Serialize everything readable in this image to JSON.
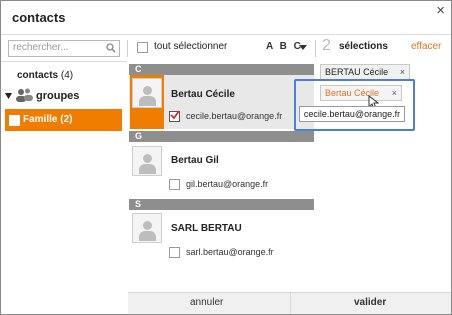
{
  "dialog": {
    "title": "contacts",
    "close_glyph": "×"
  },
  "toolbar": {
    "search_placeholder": "rechercher...",
    "select_all_label": "tout sélectionner",
    "sort_label": "A B C",
    "selection_count": "2",
    "selections_label": "sélections",
    "clear_label": "effacer"
  },
  "sidebar": {
    "contacts_label": "contacts",
    "contacts_count": "(4)",
    "groups_label": "groupes",
    "famille_label": "Famille (2)"
  },
  "contacts": {
    "groups": [
      {
        "letter": "C",
        "name": "Bertau Cécile",
        "email": "cecile.bertau@orange.fr",
        "checked": true
      },
      {
        "letter": "G",
        "name": "Bertau Gil",
        "email": "gil.bertau@orange.fr",
        "checked": false
      },
      {
        "letter": "S",
        "name": "SARL BERTAU",
        "email": "sarl.bertau@orange.fr",
        "checked": false
      }
    ]
  },
  "selections": {
    "chips": [
      {
        "label": "BERTAU Cécile",
        "remove": "×"
      },
      {
        "label": "Bertau Cécile",
        "remove": "×"
      }
    ],
    "tooltip": "cecile.bertau@orange.fr"
  },
  "footer": {
    "cancel_label": "annuler",
    "validate_label": "valider"
  },
  "colors": {
    "accent": "#f07d00",
    "link": "#e8731b",
    "highlight_border": "#4a7fd4",
    "group_header": "#8e8e8e"
  }
}
